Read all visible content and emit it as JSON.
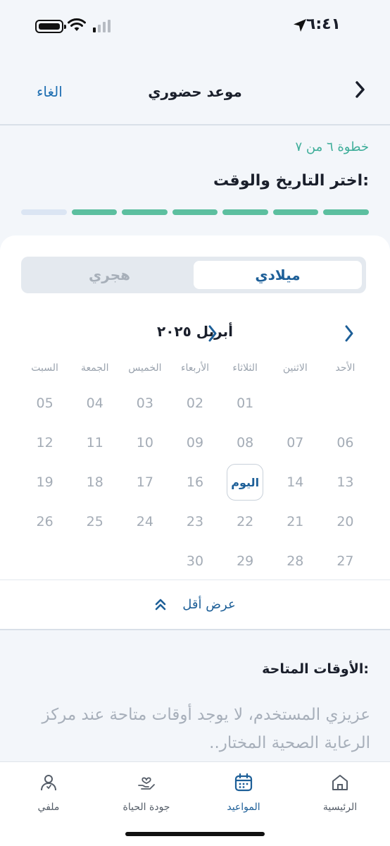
{
  "status_bar": {
    "time": "٦:٤١"
  },
  "header": {
    "cancel_label": "الغاء",
    "title": "موعد حضوري"
  },
  "step": {
    "label": "خطوة ٦ من ٧",
    "title": "اختر التاريخ والوقت:",
    "completed": 6,
    "total": 7
  },
  "calendar": {
    "segments": {
      "gregorian": "ميلادي",
      "hijri": "هجري",
      "selected": "gregorian"
    },
    "month_label": "أبريل ٢٠٢٥",
    "weekdays": [
      "الأحد",
      "الاثنين",
      "الثلاثاء",
      "الأربعاء",
      "الخميس",
      "الجمعة",
      "السبت"
    ],
    "days": [
      "",
      "",
      "01",
      "02",
      "03",
      "04",
      "05",
      "06",
      "07",
      "08",
      "09",
      "10",
      "11",
      "12",
      "13",
      "14",
      "اليوم",
      "16",
      "17",
      "18",
      "19",
      "20",
      "21",
      "22",
      "23",
      "24",
      "25",
      "26",
      "27",
      "28",
      "29",
      "30",
      "",
      "",
      ""
    ],
    "today_label": "اليوم",
    "show_less_label": "عرض أقل"
  },
  "times": {
    "title": "الأوقات المتاحة:",
    "empty_message": "عزيزي المستخدم، لا يوجد أوقات متاحة عند مركز الرعاية الصحية المختار.."
  },
  "tabbar": {
    "home": "الرئيسية",
    "appointments": "المواعيد",
    "quality_of_life": "جودة الحياة",
    "profile": "ملفي",
    "active": "appointments"
  },
  "colors": {
    "accent": "#1d5f98",
    "step_green": "#5cbf9f",
    "muted": "#a7afba"
  }
}
